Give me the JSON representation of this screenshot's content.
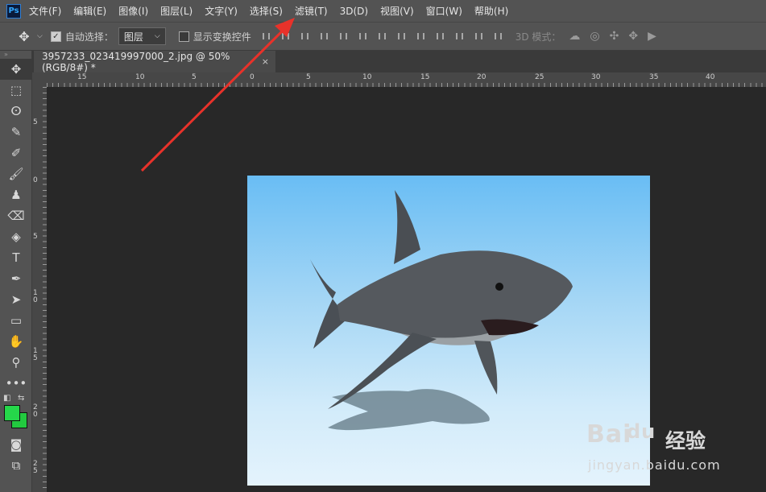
{
  "app": {
    "logo": "Ps"
  },
  "menu": [
    "文件(F)",
    "编辑(E)",
    "图像(I)",
    "图层(L)",
    "文字(Y)",
    "选择(S)",
    "滤镜(T)",
    "3D(D)",
    "视图(V)",
    "窗口(W)",
    "帮助(H)"
  ],
  "options": {
    "auto_select_label": "自动选择：",
    "auto_select_checked": true,
    "auto_select_target": "图层",
    "show_transform_label": "显示变换控件",
    "show_transform_checked": false,
    "mode_3d_label": "3D 模式："
  },
  "document": {
    "tab_title": "3957233_023419997000_2.jpg @ 50%(RGB/8#) *",
    "close_glyph": "×"
  },
  "rulers": {
    "top_labels": [
      "15",
      "10",
      "5",
      "0",
      "5",
      "10",
      "15",
      "20",
      "25",
      "30",
      "35",
      "40"
    ],
    "left_labels": [
      "5",
      "0",
      "5",
      "1 0",
      "1 5",
      "2 0",
      "2 5"
    ]
  },
  "toolbar": {
    "tools": [
      "move-tool",
      "marquee-tool",
      "lasso-tool",
      "quick-select-tool",
      "eyedropper-tool",
      "brush-tool",
      "stamp-tool",
      "eraser-tool",
      "fill-tool",
      "type-tool",
      "pen-tool",
      "path-select-tool",
      "rectangle-tool",
      "hand-tool",
      "zoom-tool",
      "more-tools"
    ],
    "foreground_color": "#25d74a",
    "background_color": "#22c93f"
  },
  "annotation": {
    "arrow_color": "#e8322a"
  },
  "watermark": {
    "brand": "Bai",
    "brand_suffix": "du",
    "product": "经验",
    "url": "jingyan.baidu.com"
  }
}
